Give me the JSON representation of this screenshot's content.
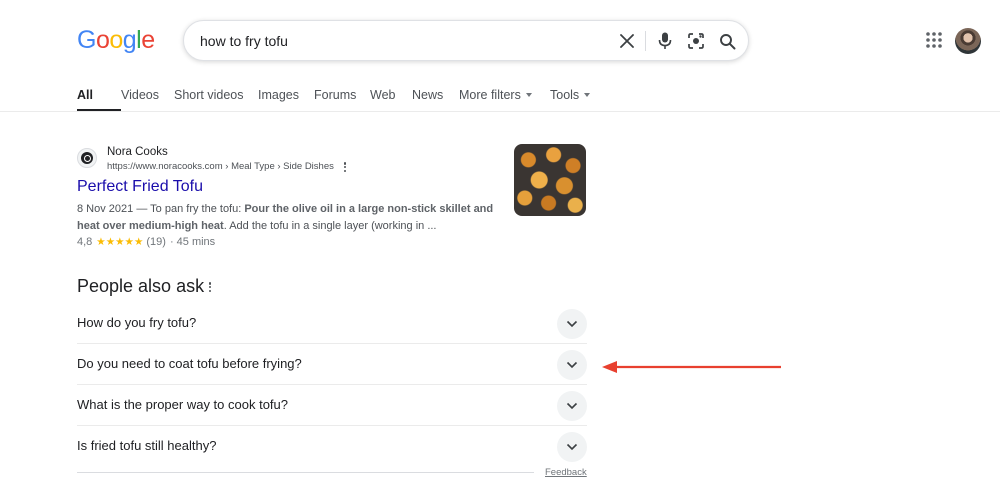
{
  "logo": {
    "letters": [
      {
        "char": "G",
        "color": "#4285F4"
      },
      {
        "char": "o",
        "color": "#EA4335"
      },
      {
        "char": "o",
        "color": "#FBBC05"
      },
      {
        "char": "g",
        "color": "#4285F4"
      },
      {
        "char": "l",
        "color": "#34A853"
      },
      {
        "char": "e",
        "color": "#EA4335"
      }
    ]
  },
  "search": {
    "query": "how to fry tofu",
    "icons": [
      "close-icon",
      "microphone-icon",
      "camera-lens-icon",
      "search-icon"
    ]
  },
  "header": {
    "apps_icon": "grid-apps-icon",
    "avatar": "user-avatar"
  },
  "tabs": [
    {
      "label": "All",
      "active": true
    },
    {
      "label": "Videos"
    },
    {
      "label": "Short videos"
    },
    {
      "label": "Images"
    },
    {
      "label": "Forums"
    },
    {
      "label": "Web"
    },
    {
      "label": "News"
    },
    {
      "label": "More filters",
      "dropdown": true
    },
    {
      "label": "Tools",
      "dropdown": true
    }
  ],
  "result": {
    "site_name": "Nora Cooks",
    "url": "https://www.noracooks.com › Meal Type › Side Dishes",
    "title": "Perfect Fried Tofu",
    "snippet_date": "8 Nov 2021 — To pan fry the tofu: ",
    "snippet_bold": "Pour the olive oil in a large non-stick skillet and heat over medium-high heat",
    "snippet_rest": ". Add the tofu in a single layer (working in ...",
    "rating_value": "4,8",
    "stars": "★★★★★",
    "rating_count": "(19)",
    "duration": "· 45 mins",
    "thumbnail": "fried-tofu-image"
  },
  "people_also_ask": {
    "heading": "People also ask",
    "questions": [
      "How do you fry tofu?",
      "Do you need to coat tofu before frying?",
      "What is the proper way to cook tofu?",
      "Is fried tofu still healthy?"
    ],
    "feedback_label": "Feedback"
  },
  "colors": {
    "link_blue": "#1a0dab",
    "annotation_red": "#E8402F",
    "star_yellow": "#fbbc04"
  }
}
